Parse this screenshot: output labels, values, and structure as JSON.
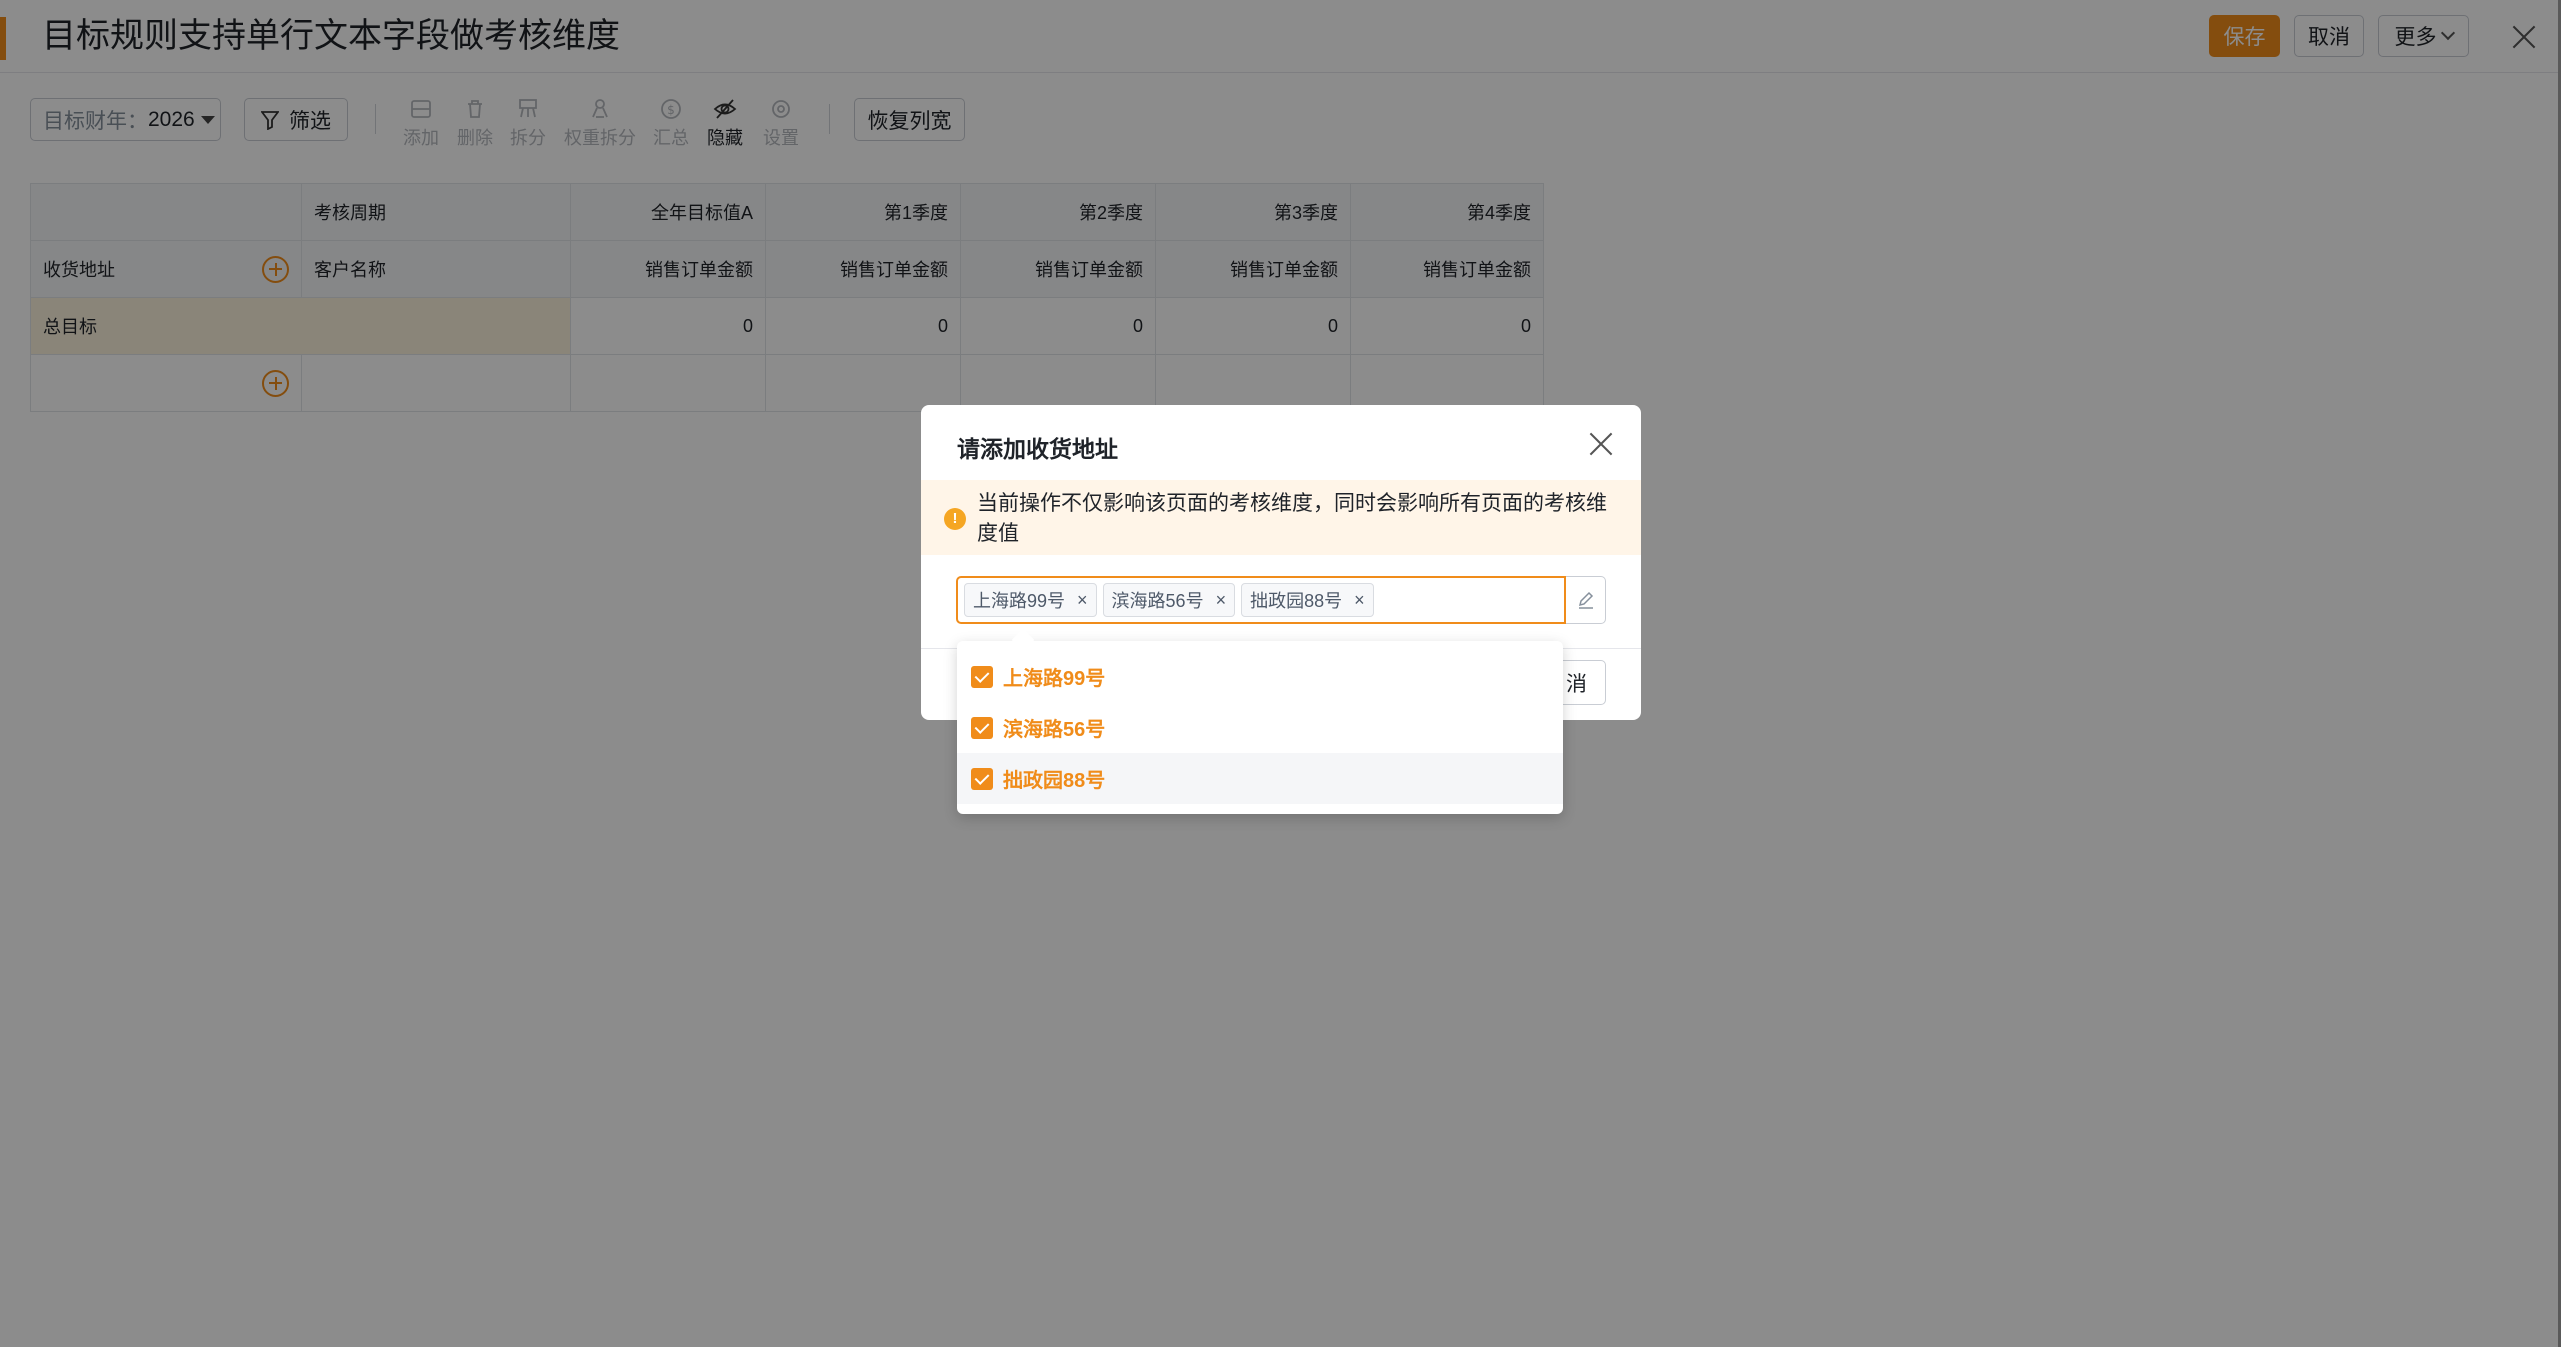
{
  "header": {
    "title": "目标规则支持单行文本字段做考核维度",
    "save_label": "保存",
    "cancel_label": "取消",
    "more_label": "更多"
  },
  "toolbar": {
    "year_label": "目标财年：",
    "year_value": "2026",
    "filter_label": "筛选",
    "tools": {
      "add": "添加",
      "delete": "删除",
      "split": "拆分",
      "weight_split": "权重拆分",
      "summary": "汇总",
      "hide": "隐藏",
      "settings": "设置"
    },
    "restore_label": "恢复列宽"
  },
  "table": {
    "period_header": "考核周期",
    "dimension_label": "收货地址",
    "customer_label": "客户名称",
    "columns": [
      "全年目标值A",
      "第1季度",
      "第2季度",
      "第3季度",
      "第4季度"
    ],
    "metric": "销售订单金额",
    "total_label": "总目标",
    "total_values": [
      "0",
      "0",
      "0",
      "0",
      "0"
    ]
  },
  "modal": {
    "title": "请添加收货地址",
    "notice": "当前操作不仅影响该页面的考核维度，同时会影响所有页面的考核维度值",
    "tags": [
      "上海路99号",
      "滨海路56号",
      "拙政园88号"
    ],
    "cancel_partial": "消"
  },
  "dropdown": {
    "options": [
      "上海路99号",
      "滨海路56号",
      "拙政园88号"
    ]
  },
  "colors": {
    "accent": "#f08c1a",
    "notice_bg": "#fff5e8",
    "total_row_bg": "#fbf3dd"
  }
}
